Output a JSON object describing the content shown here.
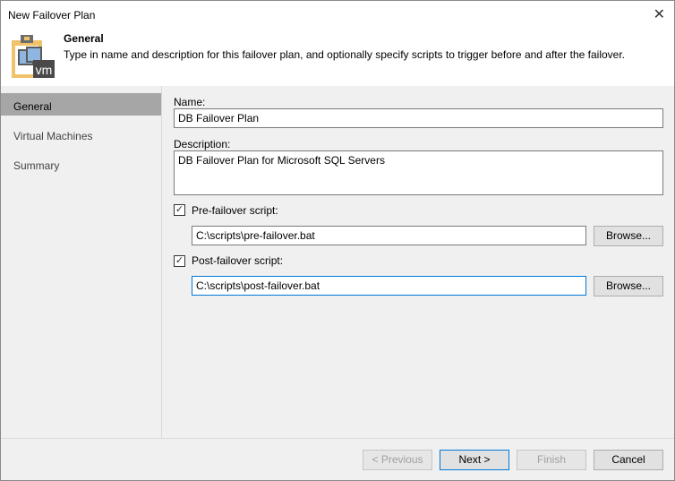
{
  "window": {
    "title": "New Failover Plan",
    "close_icon": "close-icon"
  },
  "header": {
    "title": "General",
    "description": "Type in name and description for this failover plan, and optionally specify scripts to trigger before and after the failover.",
    "icon_text": "vm"
  },
  "sidebar": {
    "items": [
      {
        "label": "General",
        "selected": true
      },
      {
        "label": "Virtual Machines"
      },
      {
        "label": "Summary"
      }
    ]
  },
  "form": {
    "name_label": "Name:",
    "name_value": "DB Failover Plan",
    "description_label": "Description:",
    "description_value": "DB Failover Plan for Microsoft SQL Servers",
    "pre_label": "Pre-failover script:",
    "pre_checked": true,
    "pre_value": "C:\\scripts\\pre-failover.bat",
    "post_label": "Post-failover script:",
    "post_checked": true,
    "post_value": "C:\\scripts\\post-failover.bat",
    "browse_label": "Browse..."
  },
  "buttons": {
    "previous": "< Previous",
    "next": "Next >",
    "finish": "Finish",
    "cancel": "Cancel"
  }
}
